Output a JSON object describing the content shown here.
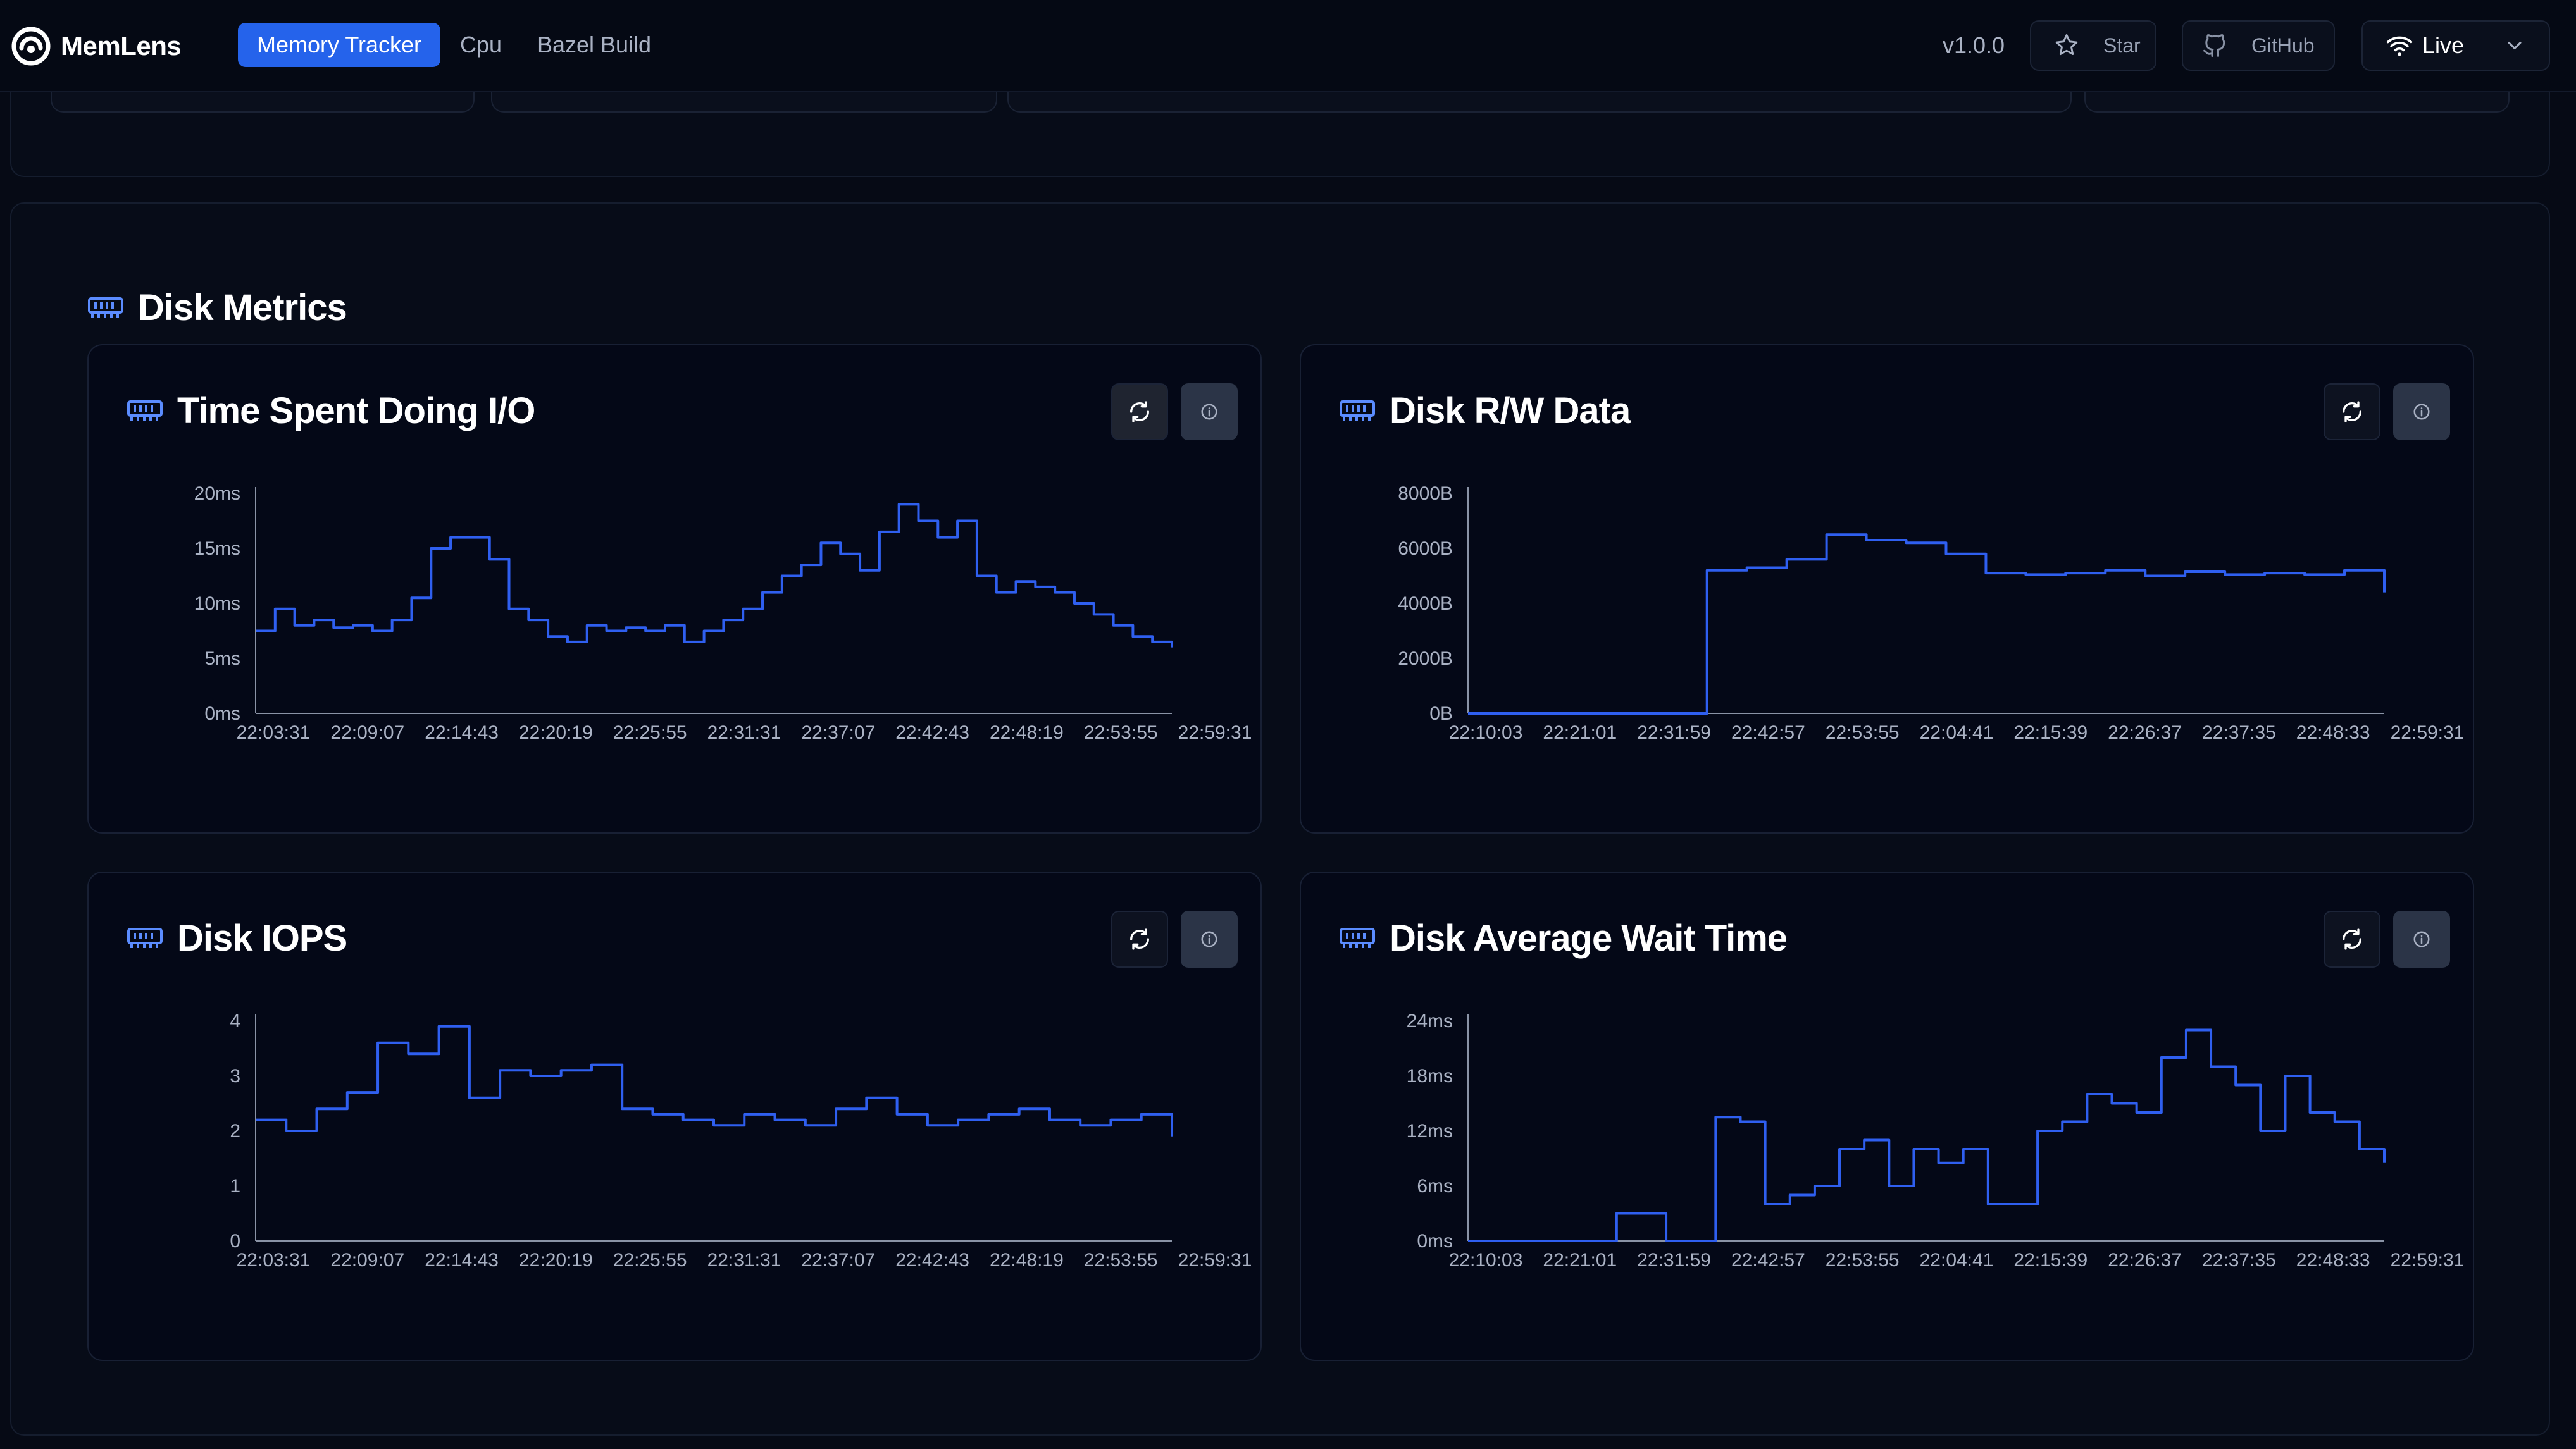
{
  "app": {
    "name": "MemLens",
    "version": "v1.0.0"
  },
  "nav": {
    "tabs": [
      {
        "label": "Memory Tracker",
        "active": true
      },
      {
        "label": "Cpu",
        "active": false
      },
      {
        "label": "Bazel Build",
        "active": false
      }
    ]
  },
  "topbar": {
    "star_label": "Star",
    "github_label": "GitHub",
    "live_label": "Live"
  },
  "icons": {
    "logo": "memlens-logo-icon",
    "star": "star-icon",
    "github": "github-icon",
    "live": "wifi-icon",
    "dropdown": "chevron-down-icon",
    "section": "memory-chip-icon",
    "refresh": "refresh-icon",
    "info": "info-icon"
  },
  "colors": {
    "accent": "#2563eb",
    "series": "#2f5ff0",
    "background": "#060a15"
  },
  "section": {
    "title": "Disk Metrics"
  },
  "chart_data": [
    {
      "id": "io",
      "type": "line",
      "title": "Time Spent Doing I/O",
      "y_unit": "ms",
      "ylim": [
        0,
        20
      ],
      "y_ticks": [
        "20ms",
        "15ms",
        "10ms",
        "5ms",
        "0ms"
      ],
      "x_ticks": [
        "22:03:31",
        "22:09:07",
        "22:14:43",
        "22:20:19",
        "22:25:55",
        "22:31:31",
        "22:37:07",
        "22:42:43",
        "22:48:19",
        "22:53:55",
        "22:59:31"
      ],
      "x": [
        "22:03:31",
        "22:05:25",
        "22:06:49",
        "22:08:13",
        "22:09:07",
        "22:10:59",
        "22:12:23",
        "22:13:17",
        "22:14:43",
        "22:15:37",
        "22:16:31",
        "22:17:25",
        "22:18:19",
        "22:19:13",
        "22:20:19",
        "22:21:13",
        "22:22:07",
        "22:23:01",
        "22:23:55",
        "22:25:55",
        "22:27:19",
        "22:28:43",
        "22:30:07",
        "22:31:31",
        "22:32:55",
        "22:34:19",
        "22:35:43",
        "22:37:07",
        "22:38:01",
        "22:38:55",
        "22:39:49",
        "22:40:43",
        "22:41:37",
        "22:42:43",
        "22:43:37",
        "22:44:31",
        "22:45:25",
        "22:46:19",
        "22:47:13",
        "22:48:19",
        "22:49:43",
        "22:51:07",
        "22:52:31",
        "22:53:55",
        "22:55:19",
        "22:56:43",
        "22:58:07",
        "22:59:31"
      ],
      "values": [
        7.5,
        9.5,
        8,
        8.5,
        7.8,
        8,
        7.5,
        8.5,
        10.5,
        15,
        16,
        16,
        14,
        9.5,
        8.5,
        7,
        6.5,
        8,
        7.5,
        7.8,
        7.5,
        8,
        6.5,
        7.5,
        8.5,
        9.5,
        11,
        12.5,
        13.5,
        15.5,
        14.5,
        13,
        16.5,
        19,
        17.5,
        16,
        17.5,
        12.5,
        11,
        12,
        11.5,
        11,
        10,
        9,
        8,
        7,
        6.5,
        6
      ]
    },
    {
      "id": "rw",
      "type": "line",
      "title": "Disk R/W Data",
      "y_unit": "B",
      "ylim": [
        0,
        8000
      ],
      "y_ticks": [
        "8000B",
        "6000B",
        "4000B",
        "2000B",
        "0B"
      ],
      "x_ticks": [
        "22:10:03",
        "22:21:01",
        "22:31:59",
        "22:42:57",
        "22:53:55",
        "22:04:41",
        "22:15:39",
        "22:26:37",
        "22:37:35",
        "22:48:33",
        "22:59:31"
      ],
      "x": [
        "22:10:03",
        "22:21:01",
        "22:31:59",
        "22:42:57",
        "22:53:55",
        "22:57:40",
        "22:58:10",
        "22:59:00",
        "22:04:41",
        "22:06:30",
        "22:09:00",
        "22:11:30",
        "22:13:00",
        "22:15:39",
        "22:18:00",
        "22:22:00",
        "22:26:37",
        "22:32:00",
        "22:37:35",
        "22:43:00",
        "22:48:33",
        "22:54:00",
        "22:59:00",
        "22:59:31"
      ],
      "values": [
        0,
        0,
        0,
        0,
        0,
        0,
        5200,
        5300,
        5600,
        6500,
        6300,
        6200,
        5800,
        5100,
        5050,
        5100,
        5200,
        5000,
        5150,
        5050,
        5100,
        5050,
        5200,
        4400
      ]
    },
    {
      "id": "iops",
      "type": "line",
      "title": "Disk IOPS",
      "y_unit": "",
      "ylim": [
        0,
        4
      ],
      "y_ticks": [
        "4",
        "3",
        "2",
        "1",
        "0"
      ],
      "x_ticks": [
        "22:03:31",
        "22:09:07",
        "22:14:43",
        "22:20:19",
        "22:25:55",
        "22:31:31",
        "22:37:07",
        "22:42:43",
        "22:48:19",
        "22:53:55",
        "22:59:31"
      ],
      "x": [
        "22:03:31",
        "22:04:40",
        "22:05:50",
        "22:07:00",
        "22:08:05",
        "22:09:07",
        "22:10:10",
        "22:11:20",
        "22:12:30",
        "22:13:35",
        "22:14:43",
        "22:15:50",
        "22:17:00",
        "22:18:10",
        "22:19:15",
        "22:20:19",
        "22:22:40",
        "22:25:55",
        "22:28:40",
        "22:31:31",
        "22:34:20",
        "22:37:07",
        "22:39:50",
        "22:42:43",
        "22:45:30",
        "22:48:19",
        "22:51:10",
        "22:53:55",
        "22:56:40",
        "22:58:30",
        "22:59:31"
      ],
      "values": [
        2.2,
        2.0,
        2.4,
        2.7,
        3.6,
        3.4,
        3.9,
        2.6,
        3.1,
        3.0,
        3.1,
        3.2,
        2.4,
        2.3,
        2.2,
        2.1,
        2.3,
        2.2,
        2.1,
        2.4,
        2.6,
        2.3,
        2.1,
        2.2,
        2.3,
        2.4,
        2.2,
        2.1,
        2.2,
        2.3,
        1.9
      ]
    },
    {
      "id": "wait",
      "type": "line",
      "title": "Disk Average Wait Time",
      "y_unit": "ms",
      "ylim": [
        0,
        24
      ],
      "y_ticks": [
        "24ms",
        "18ms",
        "12ms",
        "6ms",
        "0ms"
      ],
      "x_ticks": [
        "22:10:03",
        "22:21:01",
        "22:31:59",
        "22:42:57",
        "22:53:55",
        "22:04:41",
        "22:15:39",
        "22:26:37",
        "22:37:35",
        "22:48:33",
        "22:59:31"
      ],
      "x": [
        "22:10:03",
        "22:21:01",
        "22:31:59",
        "22:42:57",
        "22:43:20",
        "22:48:40",
        "22:49:00",
        "22:53:55",
        "22:54:20",
        "22:59:00",
        "22:59:40",
        "22:04:41",
        "22:06:30",
        "22:09:30",
        "22:12:00",
        "22:15:39",
        "22:18:00",
        "22:20:30",
        "22:23:30",
        "22:26:37",
        "22:29:00",
        "22:31:00",
        "22:33:30",
        "22:35:00",
        "22:36:20",
        "22:37:35",
        "22:39:30",
        "22:41:30",
        "22:43:00",
        "22:45:30",
        "22:47:00",
        "22:48:33",
        "22:50:30",
        "22:53:00",
        "22:55:00",
        "22:57:00",
        "22:58:30",
        "22:59:31"
      ],
      "values": [
        0,
        0,
        0,
        0,
        0,
        0,
        3,
        3,
        0,
        0,
        13.5,
        13,
        4,
        5,
        6,
        10,
        11,
        6,
        10,
        8.5,
        10,
        4,
        4,
        12,
        13,
        16,
        15,
        14,
        20,
        23,
        19,
        17,
        12,
        18,
        14,
        13,
        10,
        8.5
      ]
    }
  ]
}
